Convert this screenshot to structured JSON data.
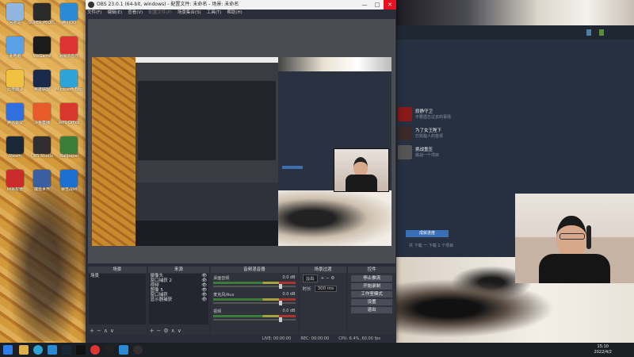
{
  "desktop": {
    "icons": [
      {
        "label": "回收站",
        "color": "#8fb6e0"
      },
      {
        "label": "SUPER PEOPLE CBT",
        "color": "#2b2b2b"
      },
      {
        "label": "腾讯QQ",
        "color": "#2a8ad4"
      },
      {
        "label": "此电脑",
        "color": "#5aa0e6"
      },
      {
        "label": "WeGame",
        "color": "#1b1b1b"
      },
      {
        "label": "网易云音乐",
        "color": "#d33"
      },
      {
        "label": "此电脑 2",
        "color": "#f0c040"
      },
      {
        "label": "英雄联盟",
        "color": "#1a2a4a"
      },
      {
        "label": "Microsoft Edge",
        "color": "#2ea3d6"
      },
      {
        "label": "腾讯会议",
        "color": "#2f6fe0"
      },
      {
        "label": "斗鱼直播",
        "color": "#e75c2a"
      },
      {
        "label": "WPS Office",
        "color": "#d9362c"
      },
      {
        "label": "Steam",
        "color": "#1b2838"
      },
      {
        "label": "OBS Studio",
        "color": "#302e31"
      },
      {
        "label": "Wallpaper",
        "color": "#3b7d3b"
      },
      {
        "label": "网易有道",
        "color": "#cc2b2b"
      },
      {
        "label": "魔兽世界",
        "color": "#3a5fa0"
      },
      {
        "label": "暴雪战网",
        "color": "#1d6fd1"
      }
    ]
  },
  "obs": {
    "title": "OBS 23.0.1 (64-bit, windows) - 配置文件: 未命名 - 场景: 未命名",
    "menu": [
      "文件(F)",
      "编辑(E)",
      "查看(V)",
      "配置文件(P)",
      "场景集合(S)",
      "工具(T)",
      "帮助(H)"
    ],
    "docks": {
      "scenes": {
        "title": "场景",
        "items": [
          "场景"
        ]
      },
      "sources": {
        "title": "来源",
        "items": [
          "摄像头",
          "窗口捕获 2",
          "视频",
          "图像 5",
          "窗口捕获",
          "显示器捕获"
        ]
      },
      "mixer": {
        "title": "音频混音器",
        "channels": [
          {
            "name": "桌面音频",
            "db": "0.0 dB"
          },
          {
            "name": "麦克风/Aux",
            "db": "0.0 dB"
          },
          {
            "name": "视频",
            "db": "0.0 dB"
          }
        ]
      },
      "transitions": {
        "title": "场景过渡",
        "type": "淡出",
        "duration_label": "时长",
        "duration": "300 ms"
      },
      "controls": {
        "title": "控件",
        "buttons": [
          "停止推流",
          "开始录制",
          "工作室模式",
          "设置",
          "退出"
        ]
      }
    },
    "status": {
      "live": "LIVE: 00:00:00",
      "rec": "REC: 00:00:00",
      "cpu": "CPU: 6.4%, 60.00 fps"
    }
  },
  "steam_panel": {
    "achievements": [
      {
        "title": "寂静守卫",
        "desc": "不要遗忘过去的事情"
      },
      {
        "title": "为了女王陛下",
        "desc": "打败敌人的首领"
      },
      {
        "title": "挑战重压",
        "desc": "挑战一个项目"
      }
    ],
    "button_label": "成就进度",
    "footnote": "共 下载 一  下载 1 个项目"
  },
  "taskbar": {
    "time": "15:10",
    "date": "2022/4/2"
  }
}
